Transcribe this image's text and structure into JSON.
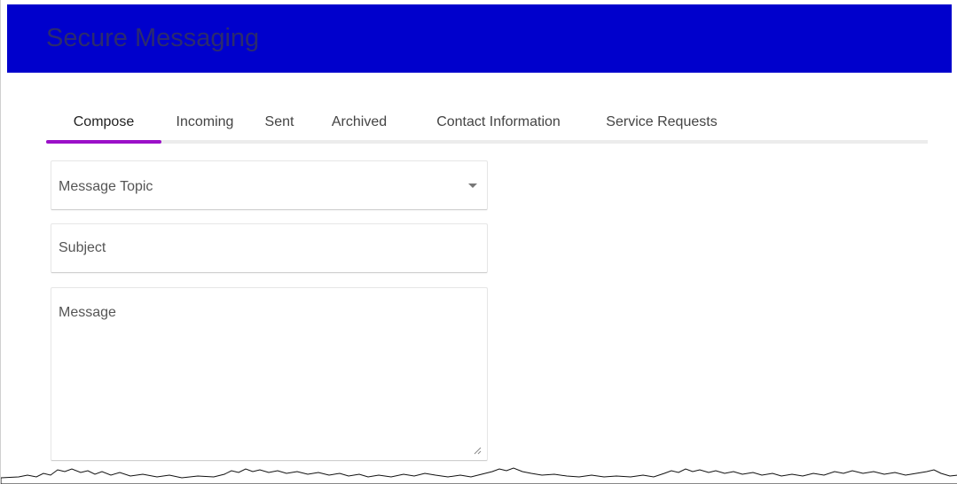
{
  "header": {
    "title": "Secure Messaging",
    "background_color": "#0000cc"
  },
  "tabs": [
    {
      "label": "Compose",
      "active": true
    },
    {
      "label": "Incoming",
      "active": false
    },
    {
      "label": "Sent",
      "active": false
    },
    {
      "label": "Archived",
      "active": false
    },
    {
      "label": "Contact Information",
      "active": false
    },
    {
      "label": "Service Requests",
      "active": false
    }
  ],
  "accent_color": "#9b10c8",
  "form": {
    "topic": {
      "placeholder": "Message Topic",
      "icon": "chevron-down-icon"
    },
    "subject": {
      "placeholder": "Subject",
      "value": ""
    },
    "message": {
      "placeholder": "Message",
      "value": "",
      "icon": "resize-handle-icon"
    }
  }
}
